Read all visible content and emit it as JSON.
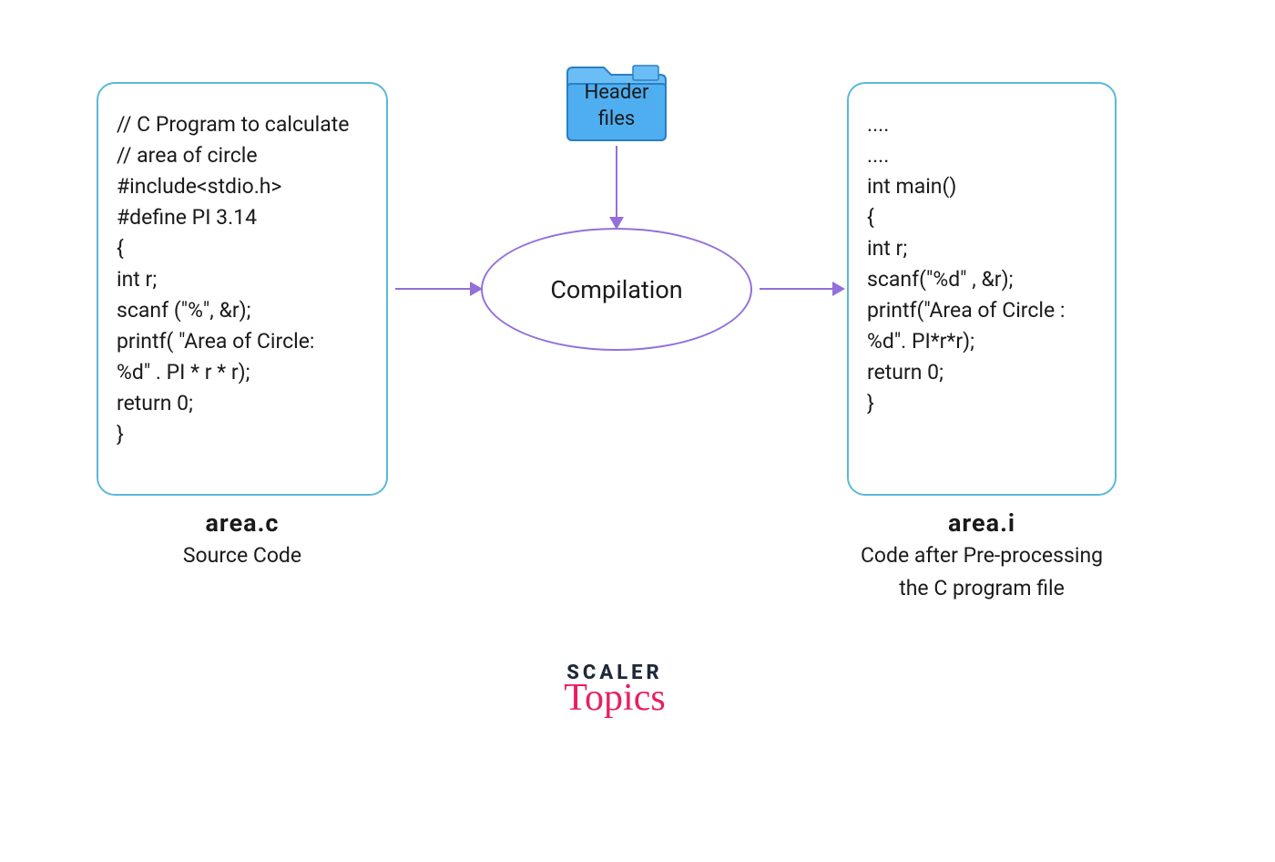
{
  "left_box": {
    "lines": [
      "// C Program to calculate",
      "// area of circle",
      "#include<stdio.h>",
      "#define PI 3.14",
      "{",
      "int r;",
      "scanf (\"%\", &r);",
      "printf( \"Area of Circle:",
      " %d\" . PI * r * r);",
      "return 0;",
      "}"
    ],
    "filename": "area.c",
    "subtitle": "Source Code"
  },
  "right_box": {
    "lines": [
      "....",
      "....",
      "int main()",
      "{",
      "int r;",
      "scanf(\"%d\" , &r);",
      "printf(\"Area of Circle :",
      "%d\". PI*r*r);",
      "return 0;",
      "}"
    ],
    "filename": "area.i",
    "subtitle_l1": "Code after Pre-processing",
    "subtitle_l2": "the C program file"
  },
  "center": {
    "ellipse_label": "Compilation"
  },
  "folder": {
    "label_l1": "Header",
    "label_l2": "files"
  },
  "logo": {
    "scaler": "SCALER",
    "topics": "Topics"
  },
  "colors": {
    "box_border": "#5bb8d9",
    "ellipse_border": "#9370db",
    "arrow": "#9370db",
    "folder": "#4faef0",
    "brand_pink": "#e91e63",
    "brand_dark": "#1e293b"
  }
}
